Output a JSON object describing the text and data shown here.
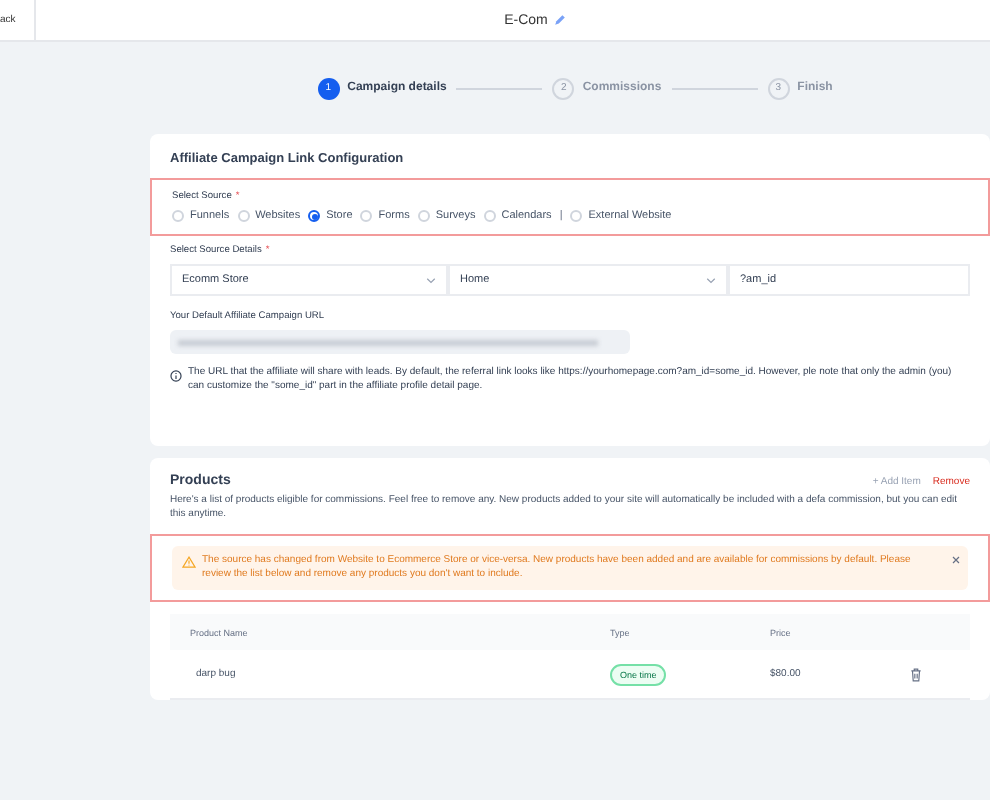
{
  "header": {
    "back": "ack",
    "title": "E-Com"
  },
  "steps": [
    {
      "number": "1",
      "label": "Campaign details",
      "selected": true
    },
    {
      "number": "2",
      "label": "Commissions",
      "selected": false
    },
    {
      "number": "3",
      "label": "Finish",
      "selected": false
    }
  ],
  "config": {
    "title": "Affiliate Campaign Link Configuration",
    "source": {
      "label": "Select Source",
      "mark": "*",
      "options": [
        {
          "kind": "radio",
          "label": "Funnels",
          "selected": false
        },
        {
          "kind": "radio",
          "label": "Websites",
          "selected": false
        },
        {
          "kind": "radio",
          "label": "Store",
          "selected": true
        },
        {
          "kind": "radio",
          "label": "Forms",
          "selected": false
        },
        {
          "kind": "radio",
          "label": "Surveys",
          "selected": false
        },
        {
          "kind": "radio",
          "label": "Calendars",
          "selected": false
        },
        {
          "kind": "divider",
          "label": "|"
        },
        {
          "kind": "radio",
          "label": "External Website",
          "selected": false
        }
      ]
    },
    "details": {
      "label": "Select Source Details",
      "mark": "*",
      "values": [
        "Ecomm Store",
        "Home",
        "?am_id"
      ]
    },
    "url_label": "Your Default Affiliate Campaign URL",
    "info": "The URL that the affiliate will share with leads. By default, the referral link looks like https://yourhomepage.com?am_id=some_id. However, ple note that only the admin (you) can customize the \"some_id\" part in the affiliate profile detail page."
  },
  "products": {
    "title": "Products",
    "add": "+ Add Item",
    "remove": "Remove",
    "description": "Here's a list of products eligible for commissions. Feel free to remove any. New products added to your site will automatically be included with a defa commission, but you can edit this anytime.",
    "alert": "The source has changed from Website to Ecommerce Store or vice-versa. New products have been added and are available for commissions by default. Please review the list below and remove any products you don't want to include.",
    "columns": [
      "Product Name",
      "Type",
      "Price"
    ],
    "rows": [
      {
        "name": "darp bug",
        "type": "One time",
        "price": "$80.00"
      }
    ]
  }
}
